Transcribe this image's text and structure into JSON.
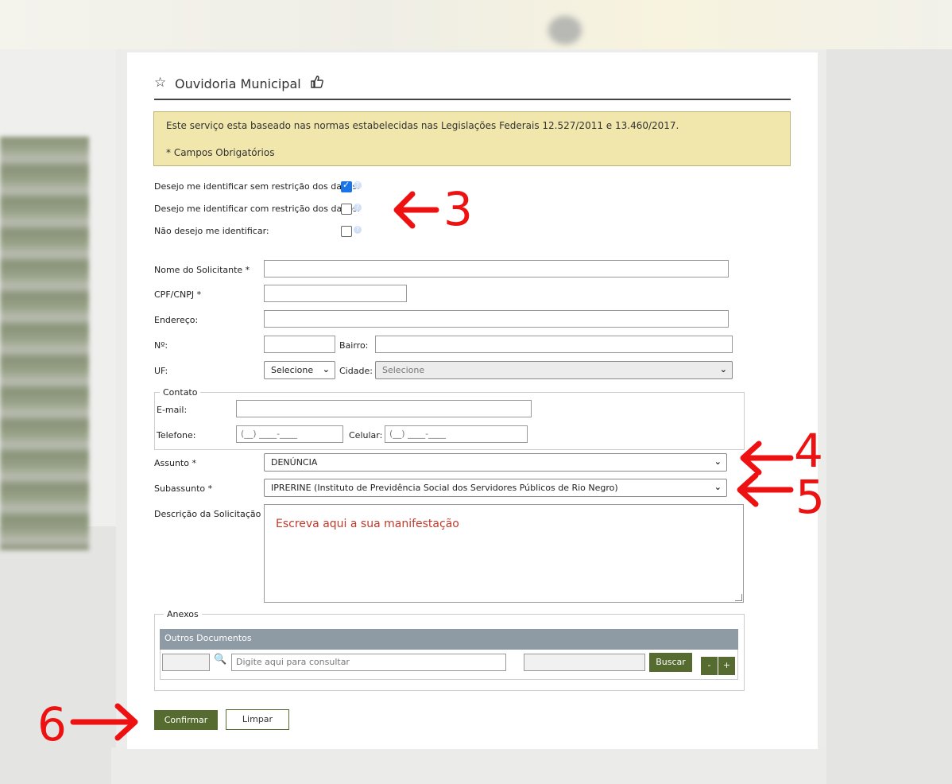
{
  "header": {
    "title": "Ouvidoria Municipal",
    "icons": [
      "star-icon",
      "thumbs-up-icon"
    ]
  },
  "notice": {
    "line1": "Este serviço esta baseado nas normas estabelecidas nas Legislações Federais 12.527/2011 e 13.460/2017.",
    "line2": "* Campos Obrigatórios"
  },
  "identification": {
    "options": [
      {
        "label": "Desejo me identificar sem restrição dos dados:",
        "checked": true
      },
      {
        "label": "Desejo me identificar com restrição dos dados:",
        "checked": false
      },
      {
        "label": "Não desejo me identificar:",
        "checked": false
      }
    ]
  },
  "form": {
    "nome_label": "Nome do Solicitante *",
    "cpf_label": "CPF/CNPJ *",
    "endereco_label": "Endereço:",
    "numero_label": "Nº:",
    "bairro_label": "Bairro:",
    "uf_label": "UF:",
    "uf_value": "Selecione",
    "cidade_label": "Cidade:",
    "cidade_value": "Selecione"
  },
  "contato": {
    "legend": "Contato",
    "email_label": "E-mail:",
    "telefone_label": "Telefone:",
    "telefone_placeholder": "(__) ____-____",
    "celular_label": "Celular:",
    "celular_placeholder": "(__) ____-____"
  },
  "assunto": {
    "label": "Assunto *",
    "value": "DENÚNCIA"
  },
  "subassunto": {
    "label": "Subassunto *",
    "value": "IPRERINE (Instituto de Previdência Social dos Servidores Públicos de Rio Negro)"
  },
  "descricao": {
    "label": "Descrição da Solicitação *",
    "text": "Escreva aqui a sua manifestação"
  },
  "anexos": {
    "legend": "Anexos",
    "table_header": "Outros Documentos",
    "search_placeholder": "Digite aqui para consultar",
    "buscar_label": "Buscar",
    "minus_label": "-",
    "plus_label": "+"
  },
  "actions": {
    "confirmar_label": "Confirmar",
    "limpar_label": "Limpar"
  },
  "annotations": {
    "a3": "3",
    "a4": "4",
    "a5": "5",
    "a6": "6",
    "color": "#ee1111"
  },
  "colors": {
    "accent_green": "#556b2f",
    "notice_bg": "#f1e6ac",
    "table_header_bg": "#8e9ba4",
    "checkbox_blue": "#1a73e8"
  }
}
